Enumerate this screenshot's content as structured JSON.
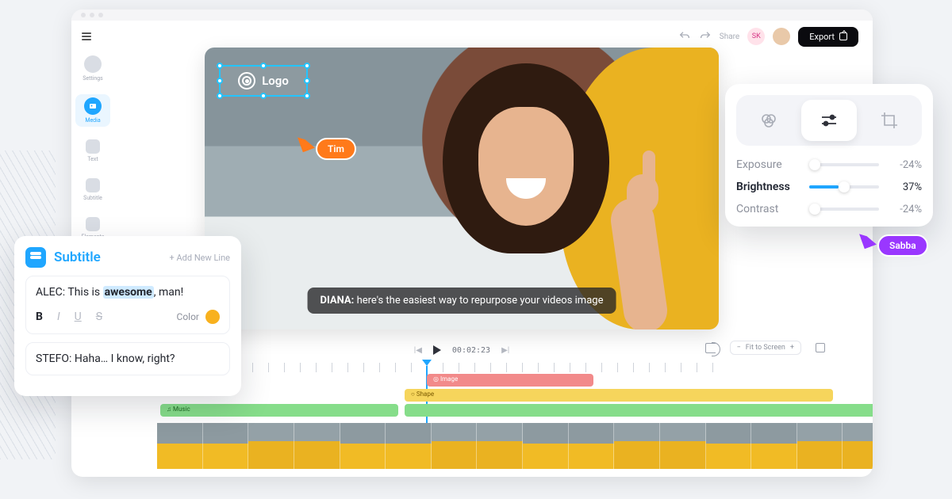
{
  "toolbar": {
    "share_label": "Share",
    "avatar_initials": "SK",
    "export_label": "Export"
  },
  "sidebar": {
    "items": [
      {
        "label": "Settings"
      },
      {
        "label": "Media"
      },
      {
        "label": "Text"
      },
      {
        "label": "Subtitle"
      },
      {
        "label": "Elements"
      }
    ]
  },
  "canvas": {
    "logo_text": "Logo",
    "caption_speaker": "DIANA:",
    "caption_text": "here's the easiest way to repurpose your videos image"
  },
  "cursors": {
    "tim": "Tim",
    "sabba": "Sabba"
  },
  "player": {
    "timecode": "00:02:23",
    "fit_label": "Fit to Screen",
    "fit_minus": "−",
    "fit_plus": "+"
  },
  "tracks": {
    "image_label": "◎ Image",
    "shape_label": "○ Shape",
    "music_label": "♫ Music"
  },
  "subtitle_panel": {
    "title": "Subtitle",
    "add_line": "+ Add New Line",
    "line1_speaker": "ALEC:",
    "line1_before": "This is ",
    "line1_highlight": "awesome",
    "line1_after": ", man!",
    "bold": "B",
    "italic": "I",
    "underline": "U",
    "strike": "S",
    "color_label": "Color",
    "line2_speaker": "STEFO:",
    "line2_text": "Haha… I know, right?"
  },
  "adjust_panel": {
    "rows": [
      {
        "label": "Exposure",
        "value": "-24%",
        "fill": 0,
        "thumb": 0
      },
      {
        "label": "Brightness",
        "value": "37%",
        "fill": 42,
        "thumb": 42
      },
      {
        "label": "Contrast",
        "value": "-24%",
        "fill": 0,
        "thumb": 0
      }
    ]
  }
}
